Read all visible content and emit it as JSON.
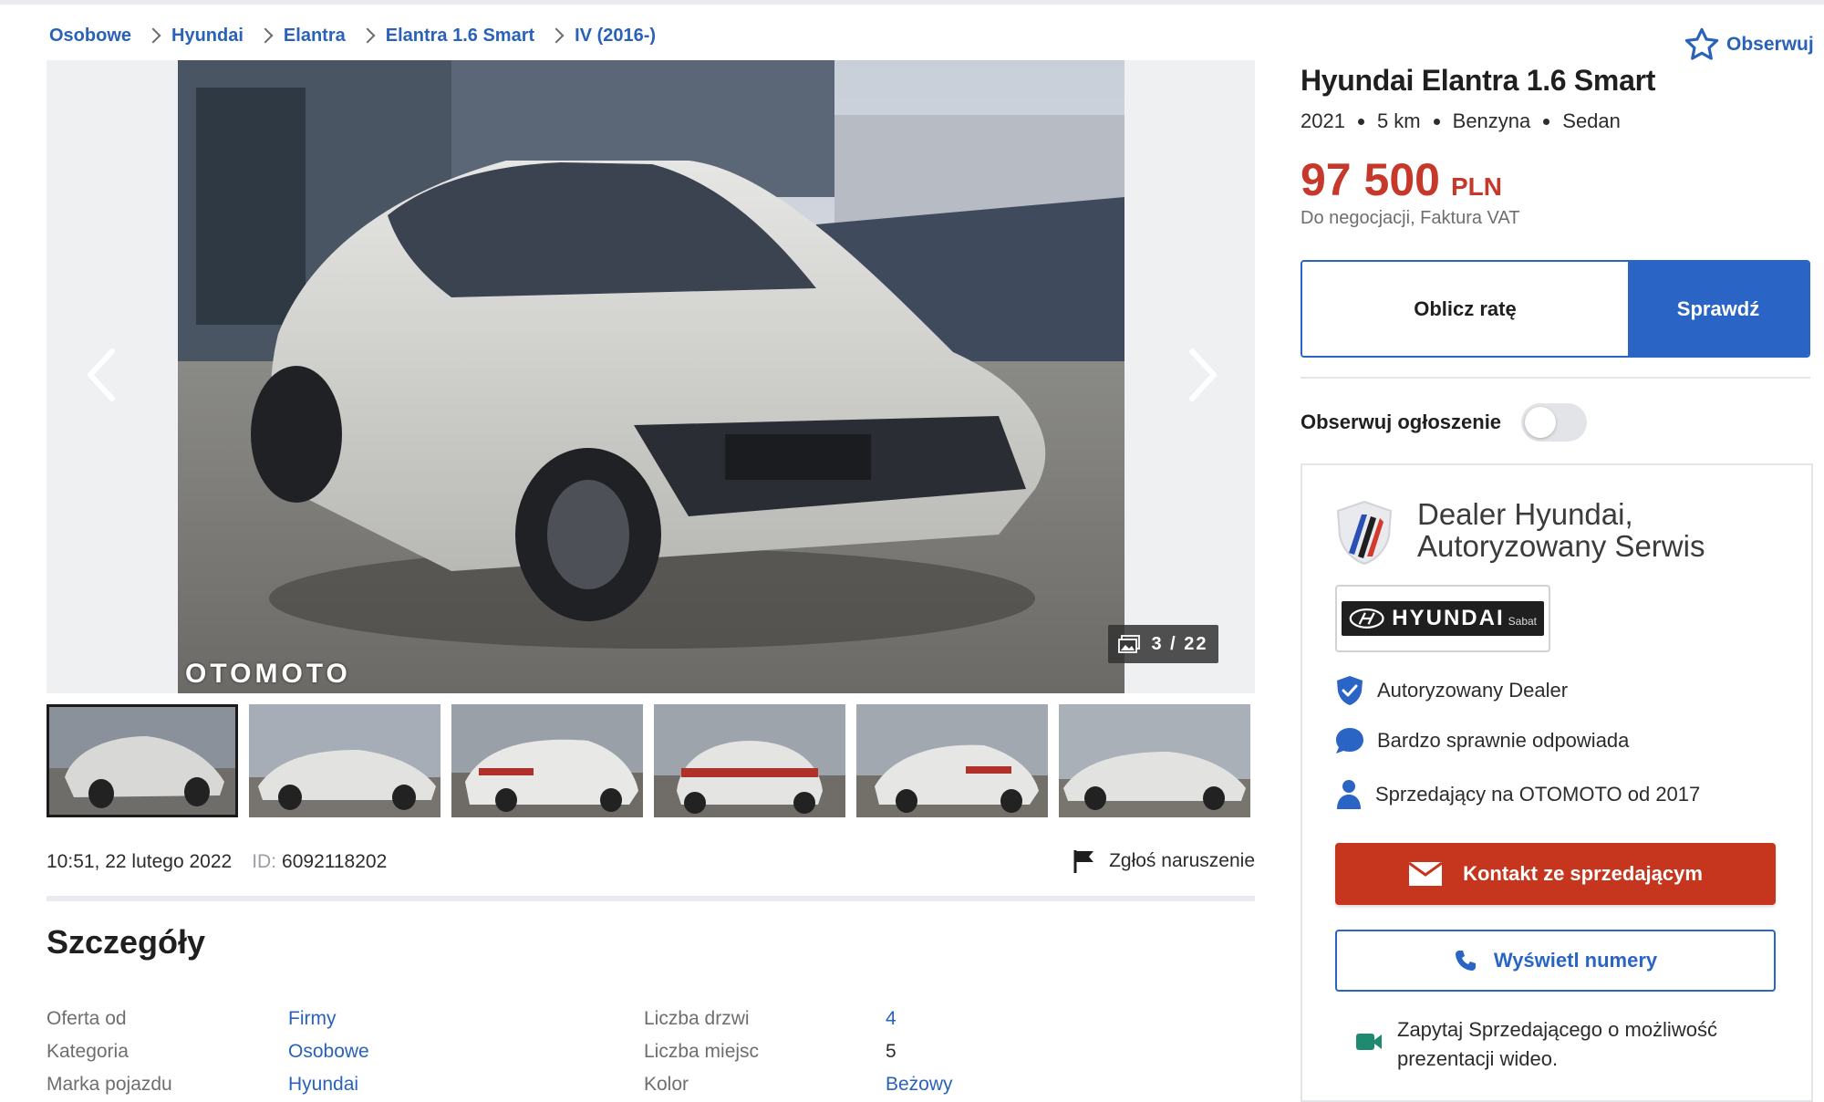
{
  "breadcrumb": [
    "Osobowe",
    "Hyundai",
    "Elantra",
    "Elantra 1.6 Smart",
    "IV (2016-)"
  ],
  "follow_top_label": "Obserwuj",
  "gallery": {
    "counter": "3 / 22",
    "watermark": "OTOMOTO",
    "thumbnail_count": 6
  },
  "meta": {
    "datetime": "10:51, 22 lutego 2022",
    "id_label": "ID:",
    "id_value": "6092118202",
    "report_label": "Zgłoś naruszenie"
  },
  "details": {
    "title": "Szczegóły",
    "rows": [
      {
        "label": "Oferta od",
        "value": "Firmy",
        "label2": "Liczba drzwi",
        "value2": "4"
      },
      {
        "label": "Kategoria",
        "value": "Osobowe",
        "label2": "Liczba miejsc",
        "value2": "5"
      },
      {
        "label": "Marka pojazdu",
        "value": "Hyundai",
        "label2": "Kolor",
        "value2": "Beżowy"
      }
    ]
  },
  "listing": {
    "title": "Hyundai Elantra 1.6 Smart",
    "specs": [
      "2021",
      "5 km",
      "Benzyna",
      "Sedan"
    ],
    "price": "97 500",
    "currency": "PLN",
    "price_note": "Do negocjacji, Faktura VAT",
    "calc_label": "Oblicz ratę",
    "check_label": "Sprawdź",
    "follow_label": "Obserwuj ogłoszenie"
  },
  "dealer": {
    "name": "Dealer Hyundai, Autoryzowany Serwis",
    "brand_text": "HYUNDAI",
    "brand_sub": "Sabat",
    "features": [
      "Autoryzowany Dealer",
      "Bardzo sprawnie odpowiada",
      "Sprzedający na OTOMOTO od 2017"
    ],
    "contact_label": "Kontakt ze sprzedającym",
    "phone_label": "Wyświetl numery",
    "video_text": "Zapytaj Sprzedającego o możliwość prezentacji wideo."
  },
  "colors": {
    "link": "#2962b8",
    "price": "#c6392a",
    "primary": "#2a64c5",
    "contact": "#c6361e"
  }
}
